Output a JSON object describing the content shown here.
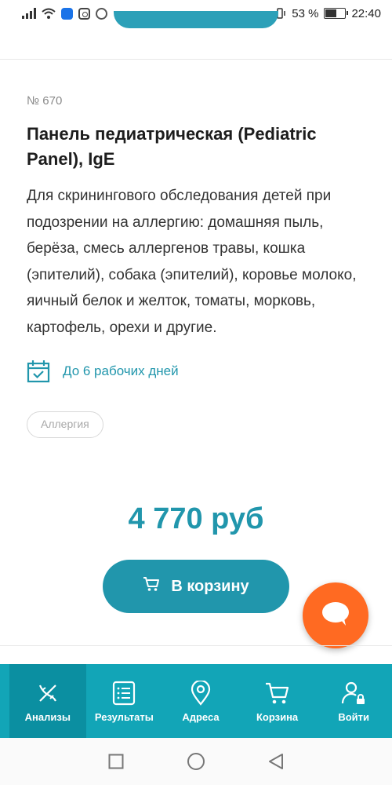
{
  "status_bar": {
    "battery_percent": "53 %",
    "battery_level": 0.53,
    "time": "22:40"
  },
  "product": {
    "number": "№ 670",
    "title": "Панель педиатрическая (Pediatric Panel), IgE",
    "description": "Для скринингового обследования детей при подозрении на аллергию: домашняя пыль, берёза, смесь аллергенов травы, кошка (эпителий), собака (эпителий), коровье молоко, яичный белок и желток, томаты, морковь, картофель, орехи и другие.",
    "turnaround": "До 6 рабочих дней",
    "tag": "Аллергия",
    "price": "4 770 руб",
    "cart_button_label": "В корзину"
  },
  "bottom_nav": {
    "items": [
      {
        "label": "Анализы",
        "icon": "dna-icon"
      },
      {
        "label": "Результаты",
        "icon": "list-icon"
      },
      {
        "label": "Адреса",
        "icon": "map-pin-icon"
      },
      {
        "label": "Корзина",
        "icon": "cart-icon"
      },
      {
        "label": "Войти",
        "icon": "user-lock-icon"
      }
    ]
  },
  "colors": {
    "accent": "#2196ac",
    "nav_bg": "#12a5b7",
    "chat_fab": "#ff6a22"
  }
}
